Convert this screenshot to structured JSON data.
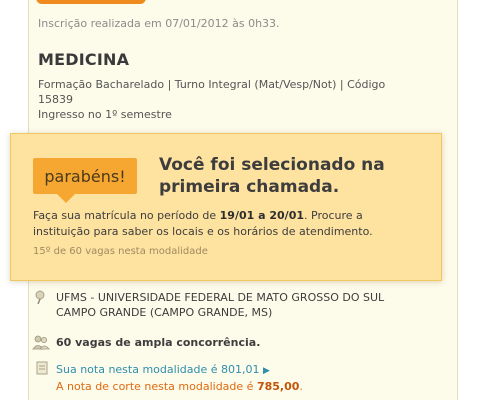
{
  "inscricao": "Inscrição realizada em 07/01/2012 às 0h33.",
  "course": {
    "title": "MEDICINA",
    "details_line1": "Formação Bacharelado | Turno Integral (Mat/Vesp/Not) | Código",
    "details_line2": "15839",
    "ingresso": "Ingresso no 1º semestre"
  },
  "popup": {
    "badge": "parabéns!",
    "headline_line1": "Você foi selecionado na",
    "headline_line2": "primeira chamada.",
    "instr_pre": "Faça sua matrícula no período de ",
    "instr_dates": "19/01 a 20/01",
    "instr_post1": ". Procure a",
    "instr_line2": "instituição para saber os locais e os horários de atendimento.",
    "vagas_note": "15º de 60 vagas nesta modalidade"
  },
  "university": {
    "line1": "UFMS - UNIVERSIDADE FEDERAL DE MATO GROSSO DO SUL",
    "line2": "CAMPO GRANDE (CAMPO GRANDE, MS)"
  },
  "vagas_ampla": "60 vagas de ampla concorrência.",
  "nota": {
    "sua_nota": "Sua nota nesta modalidade é 801,01",
    "arrow": "▶",
    "corte_pre": "A nota de corte nesta modalidade é ",
    "corte_value": "785,00",
    "corte_post": "."
  },
  "colors": {
    "accent": "#ef8a1f",
    "popup_bg": "#fee2a0",
    "badge": "#f6a732",
    "link": "#2f8fae",
    "corte": "#e06a10"
  }
}
